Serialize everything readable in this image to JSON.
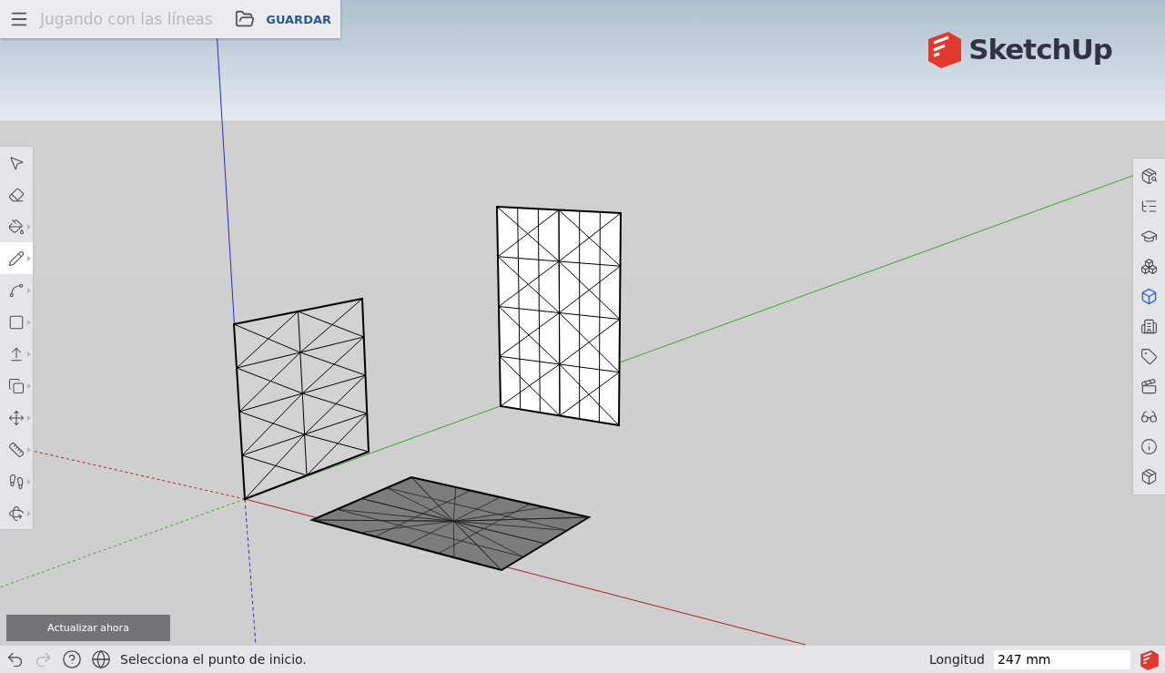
{
  "top_bar": {
    "title": "Jugando con las líneas",
    "save_label": "GUARDAR"
  },
  "logo": {
    "text": "SketchUp"
  },
  "left_tools": [
    {
      "selected": false,
      "flyout": false
    },
    {
      "selected": false,
      "flyout": false
    },
    {
      "selected": false,
      "flyout": true
    },
    {
      "selected": true,
      "flyout": true
    },
    {
      "selected": false,
      "flyout": true
    },
    {
      "selected": false,
      "flyout": true
    },
    {
      "selected": false,
      "flyout": true
    },
    {
      "selected": false,
      "flyout": true
    },
    {
      "selected": false,
      "flyout": true
    },
    {
      "selected": false,
      "flyout": true
    },
    {
      "selected": false,
      "flyout": true
    },
    {
      "selected": false,
      "flyout": true
    }
  ],
  "right_panels": [
    {
      "selected": false
    },
    {
      "selected": false
    },
    {
      "selected": false
    },
    {
      "selected": false
    },
    {
      "selected": true
    },
    {
      "selected": false
    },
    {
      "selected": false
    },
    {
      "selected": false
    },
    {
      "selected": false
    },
    {
      "selected": false
    },
    {
      "selected": false
    }
  ],
  "update_button": {
    "label": "Actualizar ahora"
  },
  "status_bar": {
    "undo_disabled": false,
    "redo_disabled": true,
    "message": "Selecciona el punto de inicio.",
    "measurement_label": "Longitud",
    "measurement_value": "247 mm"
  }
}
